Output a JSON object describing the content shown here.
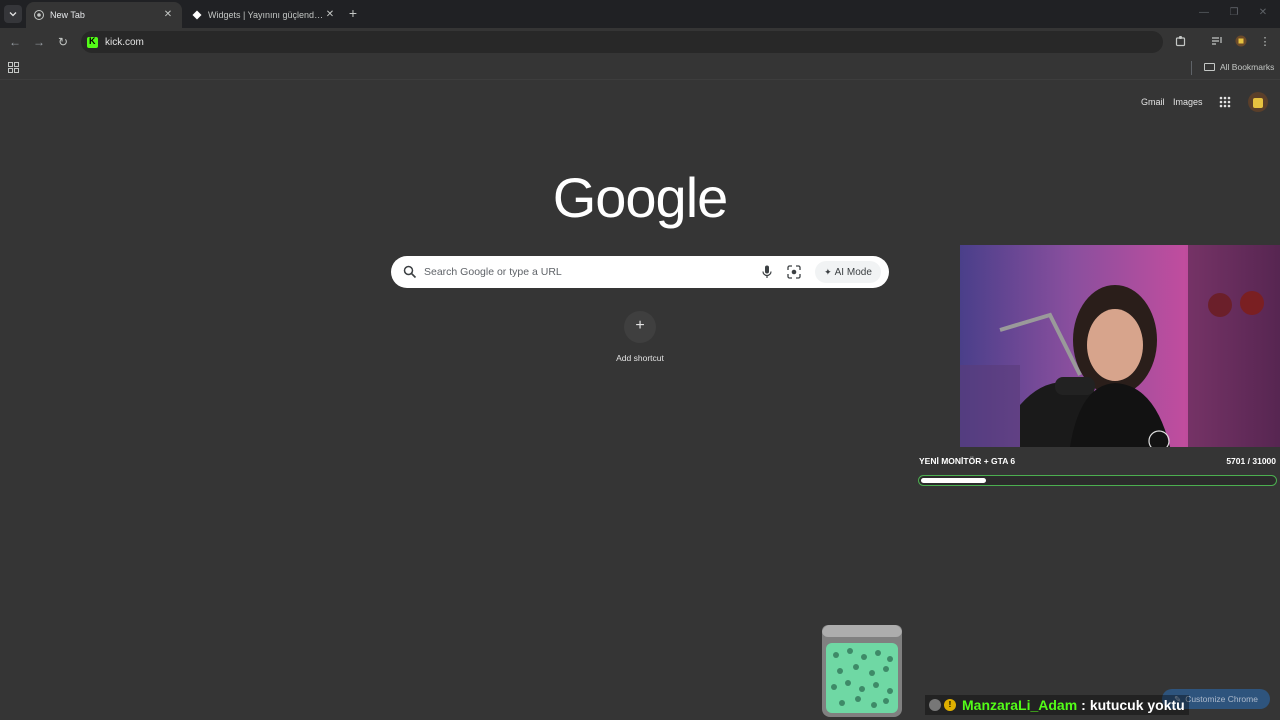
{
  "tabs": [
    {
      "title": "New Tab",
      "active": true,
      "icon": "chrome-icon"
    },
    {
      "title": "Widgets | Yayınını güçlendirmek",
      "active": false,
      "icon": "kick-widgets-icon"
    }
  ],
  "toolbar": {
    "url": "kick.com",
    "site_icon": "kick-icon"
  },
  "bookmarks_bar": {
    "all_bookmarks_label": "All Bookmarks"
  },
  "ntp": {
    "gmail_label": "Gmail",
    "images_label": "Images",
    "logo_text": "Google",
    "search_placeholder": "Search Google or type a URL",
    "ai_mode_label": "AI Mode",
    "add_shortcut_label": "Add shortcut",
    "customize_label": "Customize Chrome"
  },
  "overlay": {
    "goal_title": "YENİ MONİTÖR + GTA 6",
    "goal_current": "5701",
    "goal_separator": "/",
    "goal_target": "31000",
    "goal_fraction": 0.184,
    "chat_username": "ManzaraLi_Adam",
    "chat_separator": ":",
    "chat_message": "kutucuk yoktu",
    "accent_color": "#53fc18"
  },
  "colors": {
    "page_bg": "#353535",
    "tabstrip_bg": "#202124",
    "kick_green": "#53fc18"
  }
}
